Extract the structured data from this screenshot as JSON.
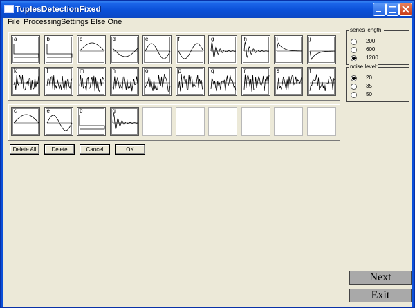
{
  "window": {
    "title": "TuplesDetectionFixed"
  },
  "menu": [
    "File",
    "Processing",
    "Settings",
    "Else One"
  ],
  "library": [
    {
      "label": "a",
      "pattern": "step-down"
    },
    {
      "label": "b",
      "pattern": "step-down"
    },
    {
      "label": "c",
      "pattern": "half-sine-up"
    },
    {
      "label": "d",
      "pattern": "half-sine-down"
    },
    {
      "label": "e",
      "pattern": "sine"
    },
    {
      "label": "f",
      "pattern": "sine-inverted"
    },
    {
      "label": "g",
      "pattern": "damped-oscillation"
    },
    {
      "label": "h",
      "pattern": "damped-oscillation"
    },
    {
      "label": "i",
      "pattern": "decay-up"
    },
    {
      "label": "j",
      "pattern": "decay-down"
    },
    {
      "label": "k",
      "pattern": "noise"
    },
    {
      "label": "l",
      "pattern": "noise"
    },
    {
      "label": "m",
      "pattern": "noise"
    },
    {
      "label": "n",
      "pattern": "noise"
    },
    {
      "label": "o",
      "pattern": "noise"
    },
    {
      "label": "p",
      "pattern": "noise"
    },
    {
      "label": "q",
      "pattern": "noise"
    },
    {
      "label": "r",
      "pattern": "noise"
    },
    {
      "label": "s",
      "pattern": "noise"
    },
    {
      "label": "t",
      "pattern": "noise"
    }
  ],
  "selection": [
    {
      "label": "c",
      "pattern": "half-sine-up"
    },
    {
      "label": "e",
      "pattern": "sine"
    },
    {
      "label": "b",
      "pattern": "step-down"
    },
    {
      "label": "g",
      "pattern": "damped-oscillation"
    },
    null,
    null,
    null,
    null,
    null,
    null
  ],
  "buttons": {
    "delete_all": "Delete All",
    "delete": "Delete",
    "cancel": "Cancel",
    "ok": "OK"
  },
  "series_length": {
    "legend": "series length:",
    "options": [
      "200",
      "600",
      "1200"
    ],
    "selected": 2
  },
  "noise_level": {
    "legend": "noise level:",
    "options": [
      "20",
      "35",
      "50"
    ],
    "selected": 0
  },
  "nav": {
    "next": "Next",
    "exit": "Exit"
  },
  "colors": {
    "titlebar": "#0a50d8",
    "face": "#ece9d8",
    "big_button": "#a9a9a9"
  }
}
